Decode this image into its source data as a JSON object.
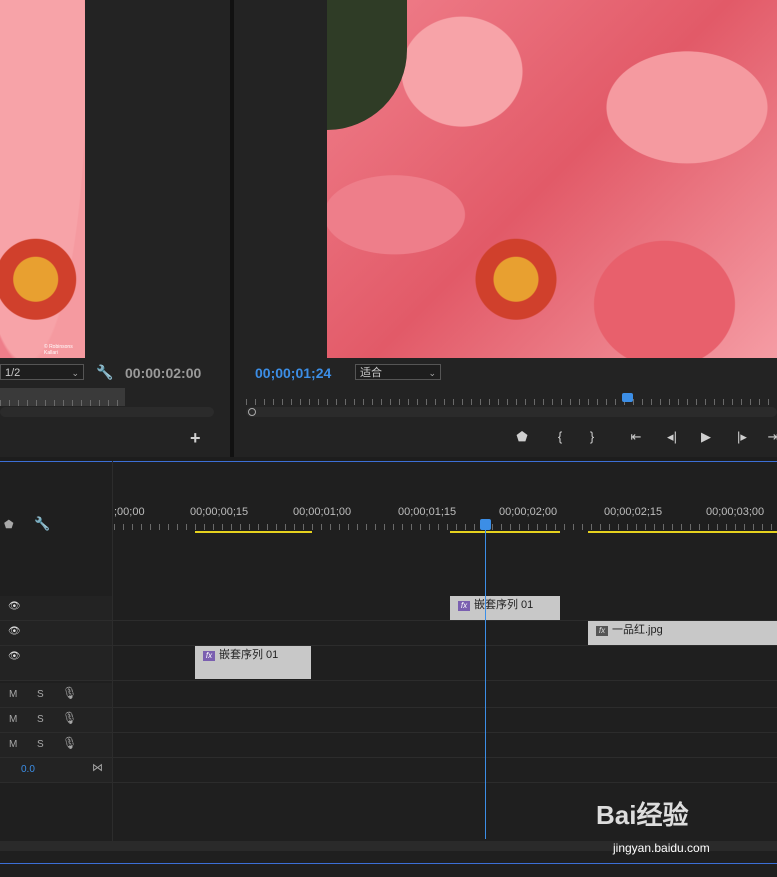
{
  "source": {
    "zoom_select": "1/2",
    "timecode": "00:00:02:00",
    "watermark": "© Robinsons Kallari",
    "add_button": "+"
  },
  "program": {
    "timecode": "00;00;01;24",
    "fit_select": "适合",
    "controls": [
      "marker-icon",
      "in-point-icon",
      "out-point-icon",
      "go-to-in-icon",
      "step-back-icon",
      "play-icon",
      "step-forward-icon",
      "go-to-out-icon"
    ]
  },
  "timeline": {
    "ruler_labels": [
      ";00;00",
      "00;00;00;15",
      "00;00;01;00",
      "00;00;01;15",
      "00;00;02;00",
      "00;00;02;15",
      "00;00;03;00"
    ],
    "video_tracks": [
      {
        "eye": "👁"
      },
      {
        "eye": "👁"
      },
      {
        "eye": "👁"
      }
    ],
    "audio_tracks": [
      {
        "m": "M",
        "s": "S"
      },
      {
        "m": "M",
        "s": "S"
      },
      {
        "m": "M",
        "s": "S"
      }
    ],
    "master_volume": "0.0",
    "clips": {
      "v3_clip": "嵌套序列 01",
      "v2_clip": "一品红.jpg",
      "v1_clip": "嵌套序列 01",
      "fx_label": "fx"
    }
  },
  "watermark": {
    "baidu_logo": "Bai经验",
    "url": "jingyan.baidu.com"
  },
  "colors": {
    "accent_blue": "#3c8ee6",
    "work_area_yellow": "#e6d21e"
  }
}
